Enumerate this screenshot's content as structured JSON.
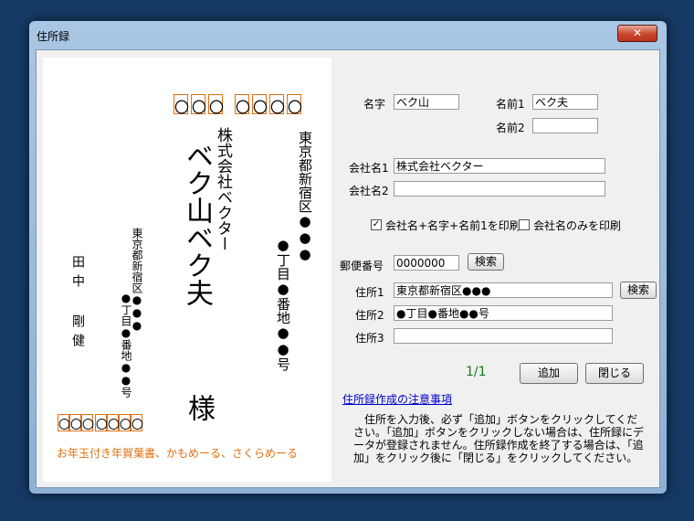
{
  "window": {
    "title": "住所録",
    "close_label": "✕"
  },
  "card": {
    "recipient_postal": [
      "〇",
      "〇",
      "〇",
      "〇",
      "〇",
      "〇",
      "〇"
    ],
    "recipient_addr1": "東京都新宿区●●●",
    "recipient_addr2": "●丁目●番地●●号",
    "recipient_company": "株式会社ベクター",
    "recipient_name": "ベク山ベク夫",
    "honorific": "様",
    "sender_name": "田中 剛健",
    "sender_addr1": "東京都新宿区●●●",
    "sender_addr2": "●丁目●番地●●号",
    "sender_postal": [
      "〇",
      "〇",
      "〇",
      "〇",
      "〇",
      "〇",
      "〇"
    ],
    "footer": "お年玉付き年賀葉書、かもめーる、さくらめーる"
  },
  "form": {
    "surname_label": "名字",
    "surname_value": "ベク山",
    "given1_label": "名前1",
    "given1_value": "ベク夫",
    "given2_label": "名前2",
    "given2_value": "",
    "company1_label": "会社名1",
    "company1_value": "株式会社ベクター",
    "company2_label": "会社名2",
    "company2_value": "",
    "print_all_label": "会社名+名字+名前1を印刷",
    "print_all_checked": true,
    "print_company_only_label": "会社名のみを印刷",
    "print_company_only_checked": false,
    "postal_label": "郵便番号",
    "postal_value": "0000000",
    "postal_search_label": "検索",
    "addr1_label": "住所1",
    "addr1_value": "東京都新宿区●●●",
    "addr_search_label": "検索",
    "addr2_label": "住所2",
    "addr2_value": "●丁目●番地●●号",
    "addr3_label": "住所3",
    "addr3_value": "",
    "record_count": "1/1",
    "add_label": "追加",
    "close_label": "閉じる",
    "notes_link": "住所録作成の注意事項",
    "notes_text": "　住所を入力後、必ず「追加」ボタンをクリックしてください。「追加」ボタンをクリックしない場合は、住所録にデータが登録されません。住所録作成を終了する場合は、「追加」をクリック後に「閉じる」をクリックしてください。"
  },
  "colors": {
    "accent_orange": "#e07010",
    "link_blue": "#0000cc",
    "count_green": "#1a7a1a"
  }
}
